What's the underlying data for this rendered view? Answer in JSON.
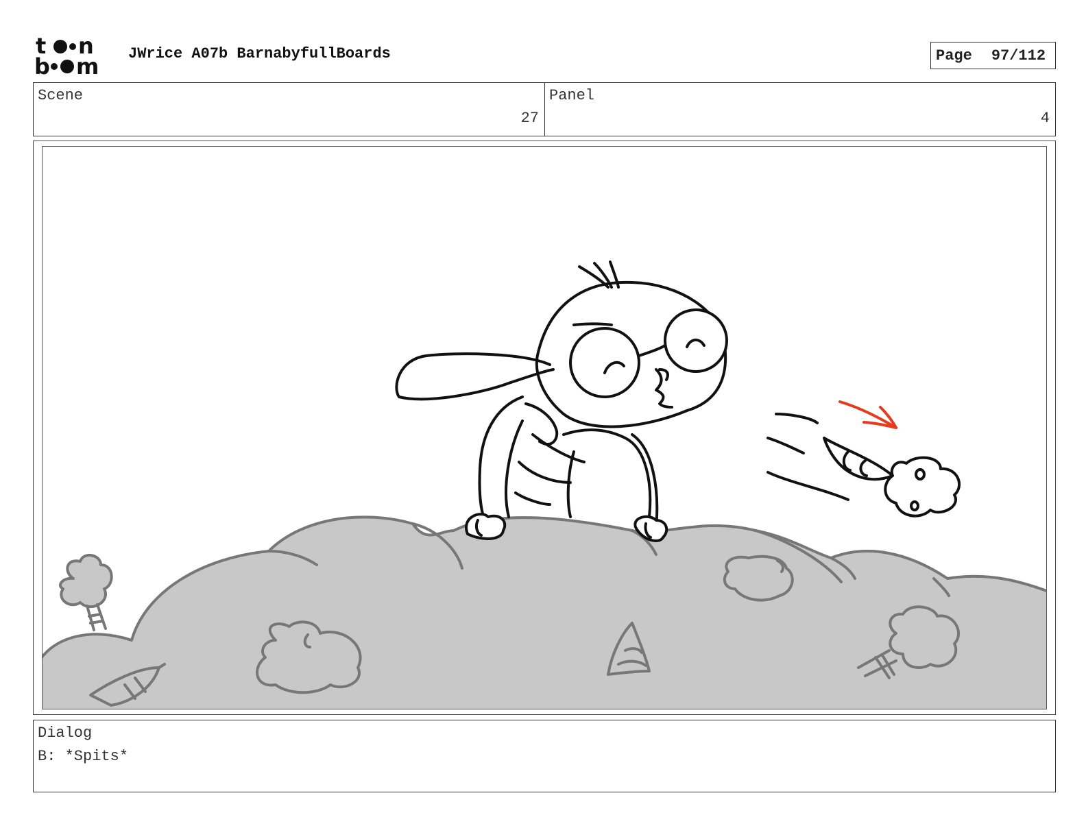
{
  "header": {
    "logo_text_top": "toon",
    "logo_text_bottom": "boom",
    "document_title": "JWrice A07b BarnabyfullBoards",
    "page_label": "Page",
    "page_number": "97/112"
  },
  "info": {
    "scene_label": "Scene",
    "scene_value": "27",
    "panel_label": "Panel",
    "panel_value": "4"
  },
  "panel_image": {
    "content_icon": "storyboard-sketch-icon",
    "colors": {
      "line": "#111111",
      "ground_fill": "#c8c8c8",
      "ground_line": "#777777",
      "action_arrow": "#e8391c"
    }
  },
  "dialog": {
    "label": "Dialog",
    "text": "B: *Spits*"
  }
}
